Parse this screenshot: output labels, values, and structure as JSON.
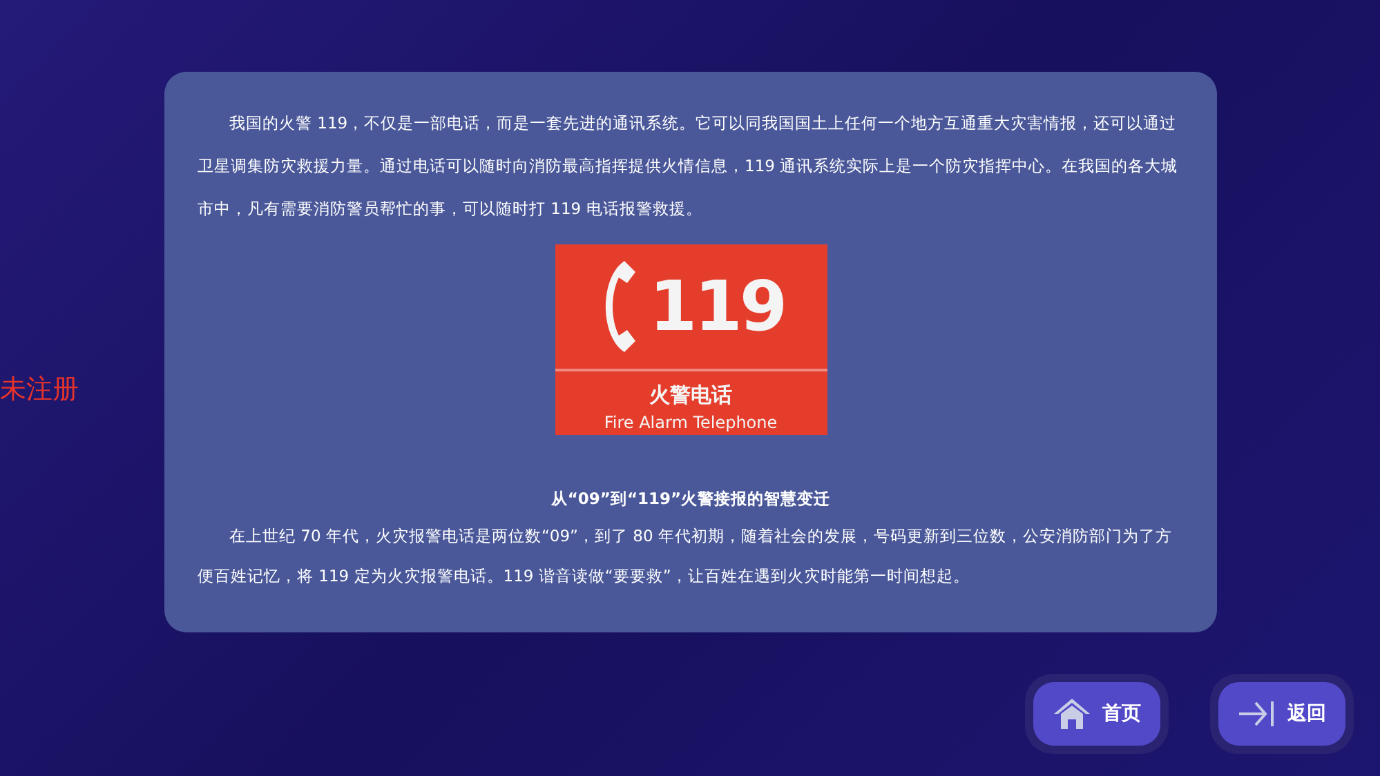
{
  "watermark_label": "未注册",
  "article": {
    "paragraphs": [
      "我国的火警 119，不仅是一部电话，而是一套先进的通讯系统。它可以同我国国土上任何一个地方互通重大灾害情报，还可以通过卫星调集防灾救援力量。通过电话可以随时向消防最高指挥提供火情信息，119 通讯系统实际上是一个防灾指挥中心。在我国的各大城市中，凡有需要消防警员帮忙的事，可以随时打 119 电话报警救援。"
    ],
    "sign": {
      "number": "119",
      "title": "火警电话",
      "subtitle": "Fire Alarm Telephone"
    },
    "heading": "从“09”到“119”火警接报的智慧变迁",
    "paragraphs_2": [
      "在上世纪 70 年代，火灾报警电话是两位数“09”，到了 80 年代初期，随着社会的发展，号码更新到三位数，公安消防部门为了方便百姓记忆，将 119 定为火灾报警电话。119 谐音读做“要要救”，让百姓在遇到火灾时能第一时间想起。"
    ]
  },
  "buttons": [
    {
      "kind": "home",
      "label": "首页"
    },
    {
      "kind": "back",
      "label": "返回"
    }
  ]
}
